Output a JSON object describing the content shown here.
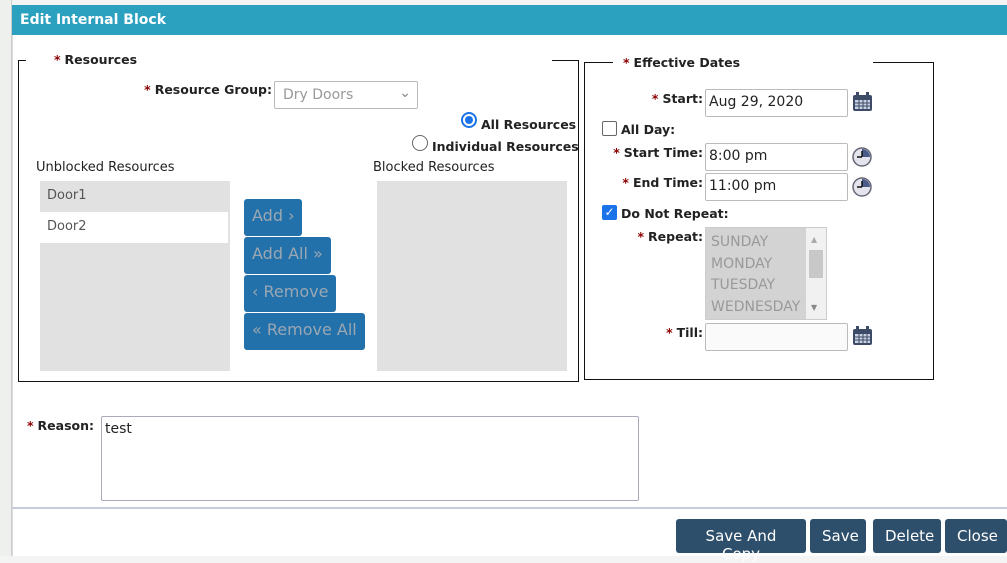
{
  "dialog": {
    "title": "Edit Internal Block"
  },
  "resources": {
    "legend": "Resources",
    "group_label": "Resource Group:",
    "group_value": "Dry Doors",
    "radio_all": "All Resources",
    "radio_individual": "Individual Resources",
    "selected_radio": "all",
    "unblocked_label": "Unblocked Resources",
    "blocked_label": "Blocked Resources",
    "unblocked": [
      "Door1",
      "Door2"
    ],
    "blocked": [],
    "buttons": {
      "add": "Add ›",
      "add_all": "Add All »",
      "remove": "‹ Remove",
      "remove_all": "« Remove All"
    }
  },
  "dates": {
    "legend": "Effective Dates",
    "start_label": "Start:",
    "start_value": "Aug 29, 2020",
    "all_day_label": "All Day:",
    "all_day": false,
    "start_time_label": "Start Time:",
    "start_time": "8:00 pm",
    "end_time_label": "End Time:",
    "end_time": "11:00 pm",
    "no_repeat_label": "Do Not Repeat:",
    "no_repeat": true,
    "repeat_label": "Repeat:",
    "repeat_options": [
      "SUNDAY",
      "MONDAY",
      "TUESDAY",
      "WEDNESDAY"
    ],
    "till_label": "Till:",
    "till_value": ""
  },
  "reason": {
    "label": "Reason:",
    "value": "test"
  },
  "required_mark": "*",
  "footer": {
    "save_copy": "Save And Copy",
    "save": "Save",
    "delete": "Delete",
    "close": "Close"
  }
}
